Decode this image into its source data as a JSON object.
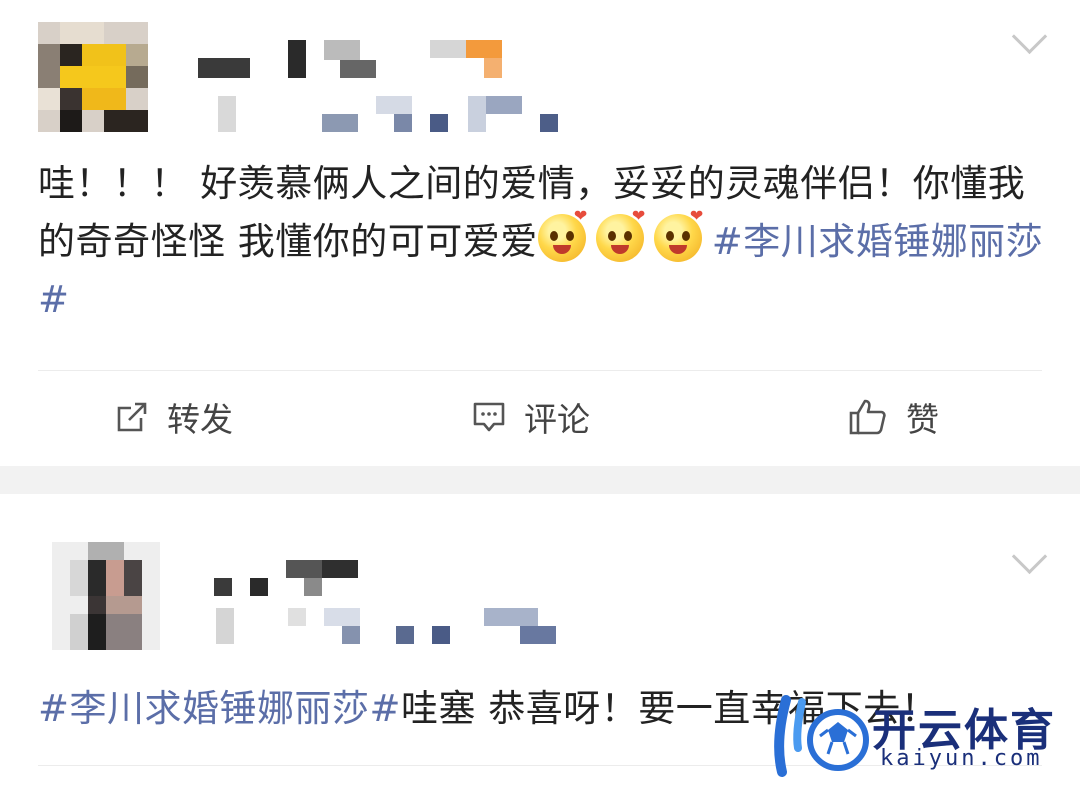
{
  "posts": [
    {
      "text_prefix": "哇！！！ 好羡慕俩人之间的爱情，妥妥的灵魂伴侣！你懂我的奇奇怪怪 我懂你的可可爱爱",
      "emojis": [
        "heart-eyes-emoji",
        "heart-eyes-emoji",
        "heart-eyes-emoji"
      ],
      "hashtag": "#李川求婚锤娜丽莎#",
      "actions": {
        "repost_label": "转发",
        "comment_label": "评论",
        "like_label": "赞"
      }
    },
    {
      "hashtag": "#李川求婚锤娜丽莎#",
      "text": "哇塞 恭喜呀！要一直幸福下去！"
    }
  ],
  "watermark": {
    "title": "开云体育",
    "url": "kaiyun.com"
  },
  "colors": {
    "hashtag": "#5b6ea8",
    "separator": "#f2f2f2",
    "watermark": "#1a2f7a"
  }
}
